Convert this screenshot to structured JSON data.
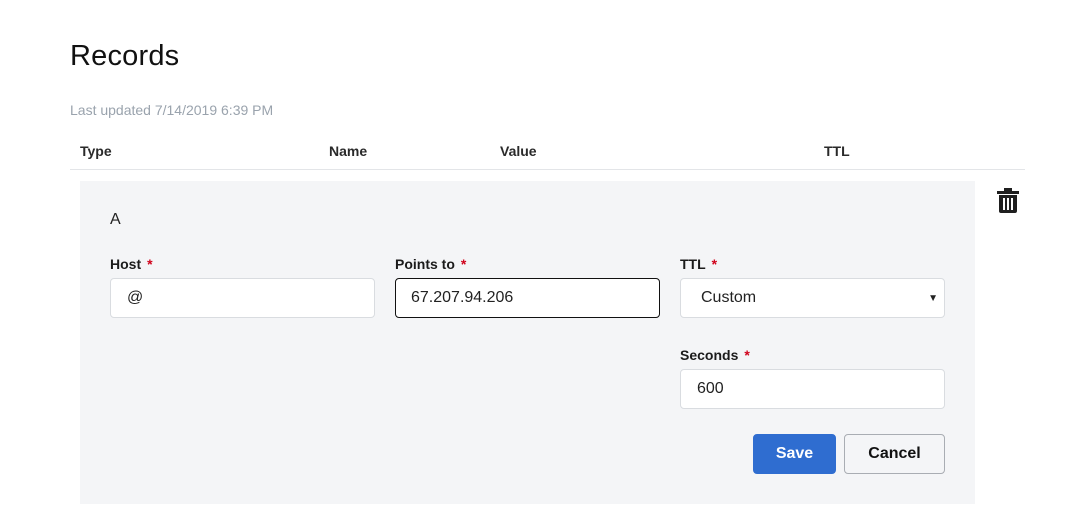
{
  "page": {
    "title": "Records",
    "last_updated": "Last updated 7/14/2019 6:39 PM"
  },
  "table": {
    "columns": [
      "Type",
      "Name",
      "Value",
      "TTL"
    ]
  },
  "record": {
    "type": "A",
    "host": {
      "label": "Host",
      "required_mark": "*",
      "value": "@"
    },
    "points_to": {
      "label": "Points to",
      "required_mark": "*",
      "value": "67.207.94.206"
    },
    "ttl": {
      "label": "TTL",
      "required_mark": "*",
      "selected": "Custom"
    },
    "seconds": {
      "label": "Seconds",
      "required_mark": "*",
      "value": "600"
    }
  },
  "actions": {
    "save_label": "Save",
    "cancel_label": "Cancel"
  },
  "icons": {
    "delete": "trash-icon",
    "dropdown": "caret-down-icon"
  },
  "colors": {
    "primary": "#2f6dd0",
    "required": "#d0021b",
    "panel_bg": "#f4f5f7"
  }
}
